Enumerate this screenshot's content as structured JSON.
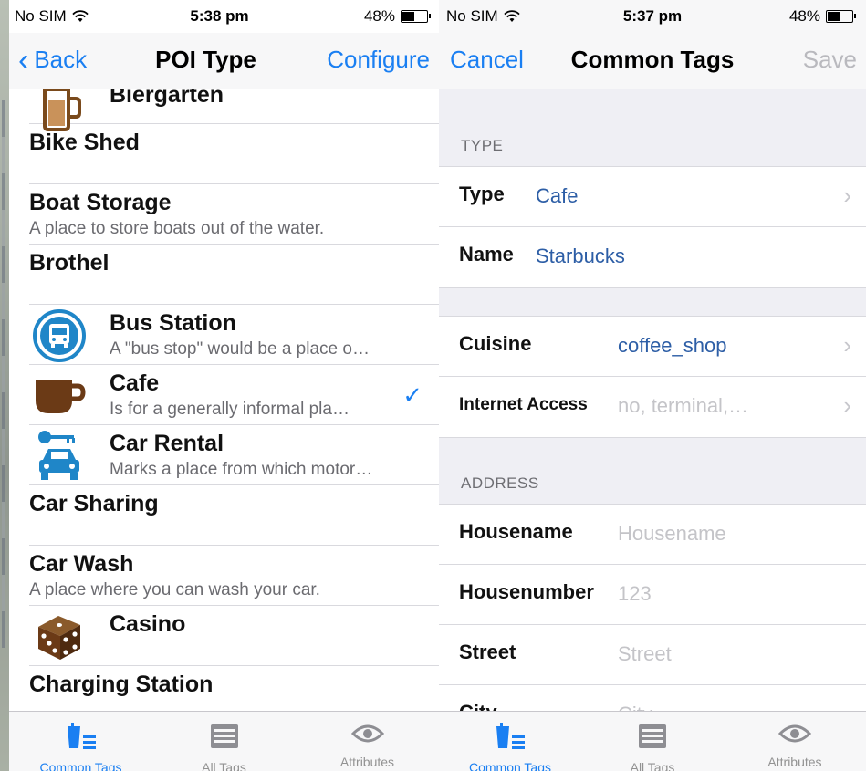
{
  "left": {
    "status": {
      "carrier": "No SIM",
      "time": "5:38 pm",
      "battery": "48%",
      "battery_level": 0.48
    },
    "nav": {
      "back": "Back",
      "title": "POI Type",
      "right": "Configure"
    },
    "items": [
      {
        "title": "Biergarten",
        "subtitle": "",
        "icon": "beer-mug-icon",
        "checked": false
      },
      {
        "title": "Bike Shed",
        "subtitle": "",
        "icon": "",
        "checked": false
      },
      {
        "title": "Boat Storage",
        "subtitle": "A place to store boats out of the water.",
        "icon": "",
        "checked": false
      },
      {
        "title": "Brothel",
        "subtitle": "",
        "icon": "",
        "checked": false
      },
      {
        "title": "Bus Station",
        "subtitle": "A \"bus stop\" would be a place o…",
        "icon": "bus-icon",
        "checked": false
      },
      {
        "title": "Cafe",
        "subtitle": "Is for a generally informal pla…",
        "icon": "coffee-cup-icon",
        "checked": true
      },
      {
        "title": "Car Rental",
        "subtitle": "Marks a place from which motor…",
        "icon": "car-key-icon",
        "checked": false
      },
      {
        "title": "Car Sharing",
        "subtitle": "",
        "icon": "",
        "checked": false
      },
      {
        "title": "Car Wash",
        "subtitle": "A place where you can wash your car.",
        "icon": "",
        "checked": false
      },
      {
        "title": "Casino",
        "subtitle": "",
        "icon": "dice-icon",
        "checked": false
      },
      {
        "title": "Charging Station",
        "subtitle": "",
        "icon": "",
        "checked": false
      }
    ],
    "tabs": [
      {
        "label": "Common Tags",
        "icon": "common-tags-icon",
        "active": true
      },
      {
        "label": "All Tags",
        "icon": "all-tags-icon",
        "active": false
      },
      {
        "label": "Attributes",
        "icon": "eye-icon",
        "active": false
      }
    ]
  },
  "right": {
    "status": {
      "carrier": "No SIM",
      "time": "5:37 pm",
      "battery": "48%",
      "battery_level": 0.48
    },
    "nav": {
      "left": "Cancel",
      "title": "Common Tags",
      "right": "Save"
    },
    "sections": {
      "type_header": "TYPE",
      "address_header": "ADDRESS"
    },
    "type_rows": [
      {
        "key": "Type",
        "value": "Cafe",
        "chevron": true
      },
      {
        "key": "Name",
        "value": "Starbucks",
        "chevron": false
      }
    ],
    "misc_rows": [
      {
        "key": "Cuisine",
        "value": "coffee_shop",
        "placeholder": "",
        "chevron": true
      },
      {
        "key": "Internet Access",
        "value": "",
        "placeholder": "no, terminal,…",
        "chevron": true
      }
    ],
    "address_rows": [
      {
        "key": "Housename",
        "value": "",
        "placeholder": "Housename"
      },
      {
        "key": "Housenumber",
        "value": "",
        "placeholder": "123"
      },
      {
        "key": "Street",
        "value": "",
        "placeholder": "Street"
      },
      {
        "key": "City",
        "value": "",
        "placeholder": "City"
      }
    ],
    "tabs": [
      {
        "label": "Common Tags",
        "icon": "common-tags-icon",
        "active": true
      },
      {
        "label": "All Tags",
        "icon": "all-tags-icon",
        "active": false
      },
      {
        "label": "Attributes",
        "icon": "eye-icon",
        "active": false
      }
    ]
  },
  "colors": {
    "accent": "#1a7ff2",
    "value_text": "#2d5ea6",
    "placeholder": "#c4c4c8",
    "group_bg": "#efeff4",
    "cafe_brown": "#6b3a16"
  }
}
